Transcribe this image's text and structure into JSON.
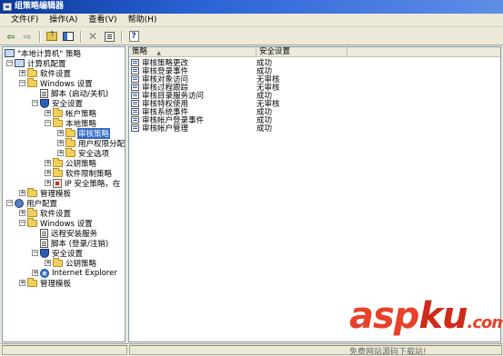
{
  "window": {
    "title": "组策略编辑器"
  },
  "menu": [
    "文件(F)",
    "操作(A)",
    "查看(V)",
    "帮助(H)"
  ],
  "tree": {
    "root": "\"本地计算机\" 策略",
    "items": [
      "计算机配置",
      "软件设置",
      "Windows 设置",
      "脚本 (启动/关机)",
      "安全设置",
      "帐户策略",
      "本地策略",
      "审核策略",
      "用户权限分配",
      "安全选项",
      "公钥策略",
      "软件限制策略",
      "IP 安全策略，在",
      "管理模板",
      "用户配置",
      "软件设置",
      "Windows 设置",
      "远程安装服务",
      "脚本 (登录/注销)",
      "安全设置",
      "公钥策略",
      "Internet Explorer",
      "管理模板"
    ]
  },
  "list": {
    "columns": [
      "策略",
      "安全设置"
    ],
    "rows": [
      {
        "policy": "审核策略更改",
        "setting": "成功"
      },
      {
        "policy": "审核登录事件",
        "setting": "成功"
      },
      {
        "policy": "审核对象访问",
        "setting": "无审核"
      },
      {
        "policy": "审核过程跟踪",
        "setting": "无审核"
      },
      {
        "policy": "审核目录服务访问",
        "setting": "成功"
      },
      {
        "policy": "审核特权使用",
        "setting": "无审核"
      },
      {
        "policy": "审核系统事件",
        "setting": "成功"
      },
      {
        "policy": "审核帐户登录事件",
        "setting": "成功"
      },
      {
        "policy": "审核帐户管理",
        "setting": "成功"
      }
    ]
  },
  "watermark": {
    "logo_a": "asp",
    "logo_b": "ku",
    "logo_c": ".com",
    "sub": "免费网站源码下载站!"
  }
}
